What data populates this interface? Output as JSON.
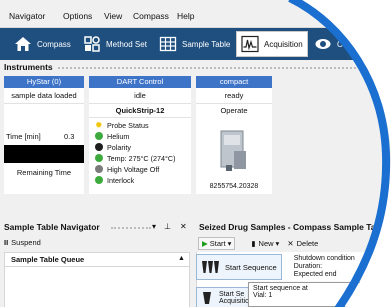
{
  "menu": [
    "Navigator",
    "Options",
    "View",
    "Compass",
    "Help"
  ],
  "toolbar": {
    "compass": "Compass",
    "method_set": "Method Set",
    "sample_table": "Sample Table",
    "acquisition": "Acquisition",
    "partial": "C"
  },
  "instruments": {
    "title": "Instruments",
    "hystar": {
      "header": "HyStar  (0)",
      "status": "sample data loaded",
      "time_label": "Time [min]",
      "time_value": "0.3",
      "remaining": "Remaining Time"
    },
    "dart": {
      "header": "DART Control",
      "state": "idle",
      "device": "QuickStrip-12",
      "status_items": [
        {
          "label": "Probe Status",
          "color": "#f2c300"
        },
        {
          "label": "Helium",
          "color": "#3daa3d"
        },
        {
          "label": "Polarity",
          "color": "#1d1d1d"
        },
        {
          "label": "Temp: 275°C (274°C)",
          "color": "#3daa3d"
        },
        {
          "label": "High Voltage Off",
          "color": "#7a7a7a"
        },
        {
          "label": "Interlock",
          "color": "#3daa3d"
        }
      ]
    },
    "compact": {
      "header": "compact",
      "state": "ready",
      "mode": "Operate",
      "serial": "8255754.20328"
    }
  },
  "navigator": {
    "title": "Sample Table Navigator",
    "suspend": "Suspend",
    "queue_title": "Sample Table Queue"
  },
  "seized": {
    "title": "Seized Drug Samples - Compass Sample Table",
    "start": "Start",
    "new": "New",
    "delete": "Delete",
    "start_sequence": "Start Sequence",
    "shutdown": "Shutdown condition",
    "duration": "Duration:",
    "expected": "Expected end",
    "second_btn": "Start Se",
    "second_sub": "Acquisition",
    "tooltip_title": "Start sequence at",
    "tooltip_vial": "Vial: 1"
  },
  "colors": {
    "toolbar_bg": "#1f4f7f",
    "header_blue": "#3e74c8",
    "ring_blue": "#1a6fd0"
  }
}
